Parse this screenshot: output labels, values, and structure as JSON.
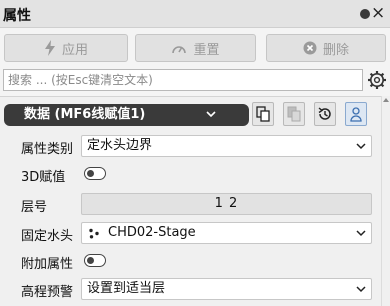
{
  "window": {
    "title": "属性"
  },
  "toolbar": {
    "apply_label": "应用",
    "reset_label": "重置",
    "delete_label": "删除"
  },
  "search": {
    "placeholder": "搜索 ... (按Esc键清空文本)",
    "value": ""
  },
  "data_section": {
    "label": "数据 (MF6线赋值1)"
  },
  "properties": {
    "category": {
      "label": "属性类别",
      "value": "定水头边界"
    },
    "assign3d": {
      "label": "3D赋值",
      "enabled": false
    },
    "layer": {
      "label": "层号",
      "value": "1 2"
    },
    "fixed_head": {
      "label": "固定水头",
      "value": "CHD02-Stage"
    },
    "extra": {
      "label": "附加属性",
      "enabled": false
    },
    "elevation_warning": {
      "label": "高程预警",
      "value": "设置到适当层"
    }
  },
  "colors": {
    "titlebar_bg": "#e3e3e3",
    "panel_bg": "#f0f0f0",
    "pill_bg": "#3a3a3a",
    "disabled_text": "#9a9a9a"
  },
  "icons": [
    "lightning-icon",
    "reset-dial-icon",
    "delete-x-icon",
    "gear-icon",
    "copy-icon",
    "paste-icon",
    "history-icon",
    "user-icon",
    "chevron-down-icon",
    "dots-icon",
    "close-icon"
  ]
}
